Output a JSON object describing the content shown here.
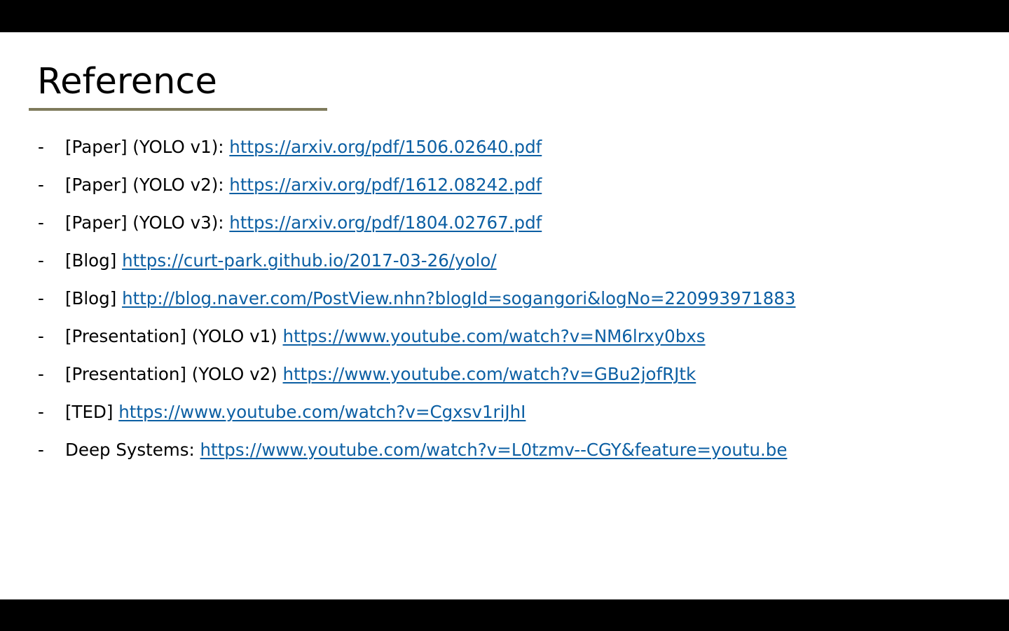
{
  "slide": {
    "title": "Reference",
    "accent_color": "#7f7b5c",
    "link_color": "#0c5fa3",
    "references": [
      {
        "bullet": "-",
        "label": "[Paper] (YOLO v1): ",
        "link": "https://arxiv.org/pdf/1506.02640.pdf"
      },
      {
        "bullet": "-",
        "label": "[Paper] (YOLO v2): ",
        "link": "https://arxiv.org/pdf/1612.08242.pdf"
      },
      {
        "bullet": "-",
        "label": "[Paper] (YOLO v3): ",
        "link": "https://arxiv.org/pdf/1804.02767.pdf"
      },
      {
        "bullet": "-",
        "label": "[Blog] ",
        "link": "https://curt-park.github.io/2017-03-26/yolo/"
      },
      {
        "bullet": "-",
        "label": "[Blog] ",
        "link": "http://blog.naver.com/PostView.nhn?blogId=sogangori&logNo=220993971883"
      },
      {
        "bullet": "-",
        "label": "[Presentation] (YOLO v1) ",
        "link": "https://www.youtube.com/watch?v=NM6lrxy0bxs"
      },
      {
        "bullet": "-",
        "label": "[Presentation] (YOLO v2) ",
        "link": "https://www.youtube.com/watch?v=GBu2jofRJtk"
      },
      {
        "bullet": "-",
        "label": "[TED] ",
        "link": "https://www.youtube.com/watch?v=Cgxsv1riJhI"
      },
      {
        "bullet": "-",
        "label": "Deep Systems: ",
        "link": "https://www.youtube.com/watch?v=L0tzmv--CGY&feature=youtu.be"
      }
    ]
  }
}
